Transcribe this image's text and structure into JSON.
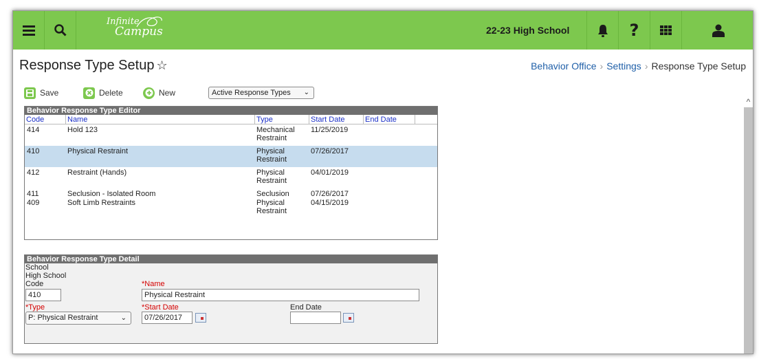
{
  "app": {
    "logo_line1": "Infinite",
    "logo_line2": "Campus",
    "school": "22-23 High School"
  },
  "icons": {
    "menu": "hamburger-icon",
    "search": "search-icon",
    "notifications": "bell-icon",
    "help": "question-icon",
    "apps": "grid-icon",
    "user": "user-icon"
  },
  "colors": {
    "topbar": "#7dc84e",
    "link": "#1f5fa8",
    "selected_row": "#c6dcee",
    "required_label": "#d40000"
  },
  "header": {
    "title": "Response Type Setup",
    "breadcrumb": [
      "Behavior Office",
      "Settings",
      "Response Type Setup"
    ]
  },
  "toolbar": {
    "save_label": "Save",
    "delete_label": "Delete",
    "new_label": "New",
    "filter_value": "Active Response Types"
  },
  "editor": {
    "title": "Behavior Response Type Editor",
    "columns": [
      "Code",
      "Name",
      "Type",
      "Start Date",
      "End Date"
    ],
    "rows": [
      {
        "code": "414",
        "name": "Hold 123",
        "type1": "Mechanical",
        "type2": "Restraint",
        "start": "11/25/2019",
        "end": ""
      },
      {
        "code": "410",
        "name": "Physical Restraint",
        "type1": "Physical",
        "type2": "Restraint",
        "start": "07/26/2017",
        "end": ""
      },
      {
        "code": "412",
        "name": "Restraint (Hands)",
        "type1": "Physical",
        "type2": "Restraint",
        "start": "04/01/2019",
        "end": ""
      },
      {
        "code": "411",
        "name": "Seclusion - Isolated Room",
        "type1": "Seclusion",
        "type2": "",
        "start": "07/26/2017",
        "end": ""
      },
      {
        "code": "409",
        "name": "Soft Limb Restraints",
        "type1": "Physical",
        "type2": "Restraint",
        "start": "04/15/2019",
        "end": ""
      }
    ],
    "selected_code": "410"
  },
  "detail": {
    "title": "Behavior Response Type Detail",
    "school_label": "School",
    "school_value": "High School",
    "code_label": "Code",
    "code_value": "410",
    "name_label": "*Name",
    "name_value": "Physical Restraint",
    "type_label": "*Type",
    "type_value": "P: Physical Restraint",
    "start_label": "*Start Date",
    "start_value": "07/26/2017",
    "end_label": "End Date",
    "end_value": ""
  }
}
